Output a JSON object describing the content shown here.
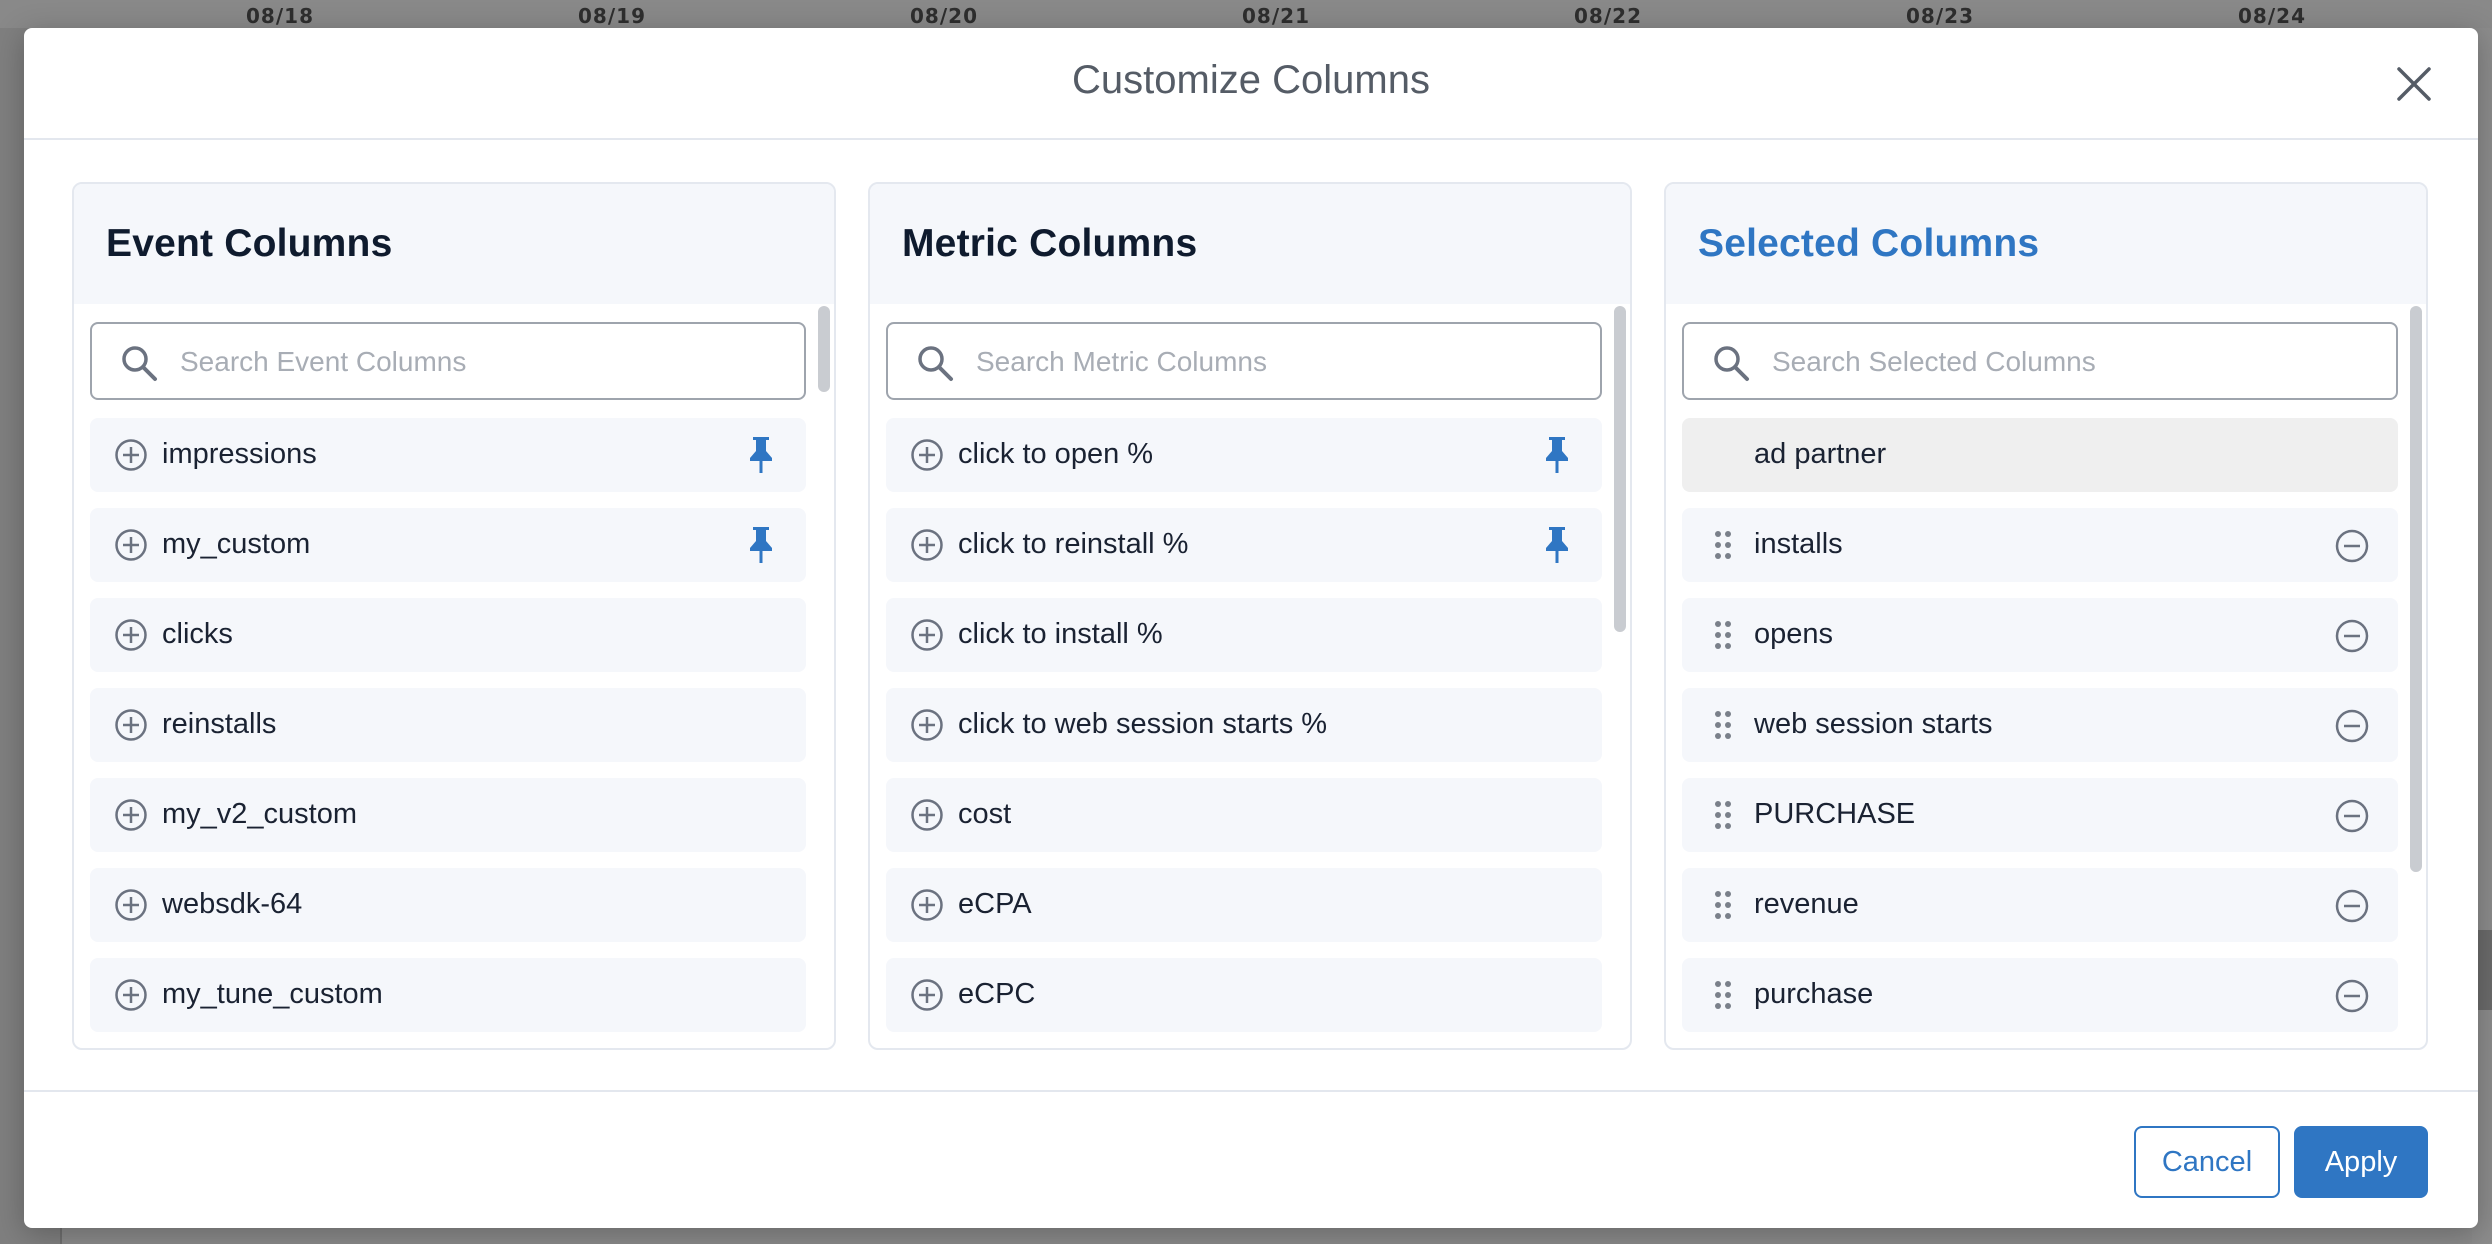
{
  "background": {
    "date_labels": [
      "08/18",
      "08/19",
      "08/20",
      "08/21",
      "08/22",
      "08/23",
      "08/24"
    ]
  },
  "modal": {
    "title": "Customize Columns",
    "close_icon": "close-icon"
  },
  "event_columns": {
    "title": "Event Columns",
    "search_placeholder": "Search Event Columns",
    "items": [
      {
        "label": "impressions",
        "pinned": true
      },
      {
        "label": "my_custom",
        "pinned": true
      },
      {
        "label": "clicks",
        "pinned": false
      },
      {
        "label": "reinstalls",
        "pinned": false
      },
      {
        "label": "my_v2_custom",
        "pinned": false
      },
      {
        "label": "websdk-64",
        "pinned": false
      },
      {
        "label": "my_tune_custom",
        "pinned": false
      }
    ]
  },
  "metric_columns": {
    "title": "Metric Columns",
    "search_placeholder": "Search Metric Columns",
    "items": [
      {
        "label": "click to open %",
        "pinned": true
      },
      {
        "label": "click to reinstall %",
        "pinned": true
      },
      {
        "label": "click to install %",
        "pinned": false
      },
      {
        "label": "click to web session starts %",
        "pinned": false
      },
      {
        "label": "cost",
        "pinned": false
      },
      {
        "label": "eCPA",
        "pinned": false
      },
      {
        "label": "eCPC",
        "pinned": false
      }
    ]
  },
  "selected_columns": {
    "title": "Selected Columns",
    "search_placeholder": "Search Selected Columns",
    "fixed_item": "ad partner",
    "items": [
      {
        "label": "installs"
      },
      {
        "label": "opens"
      },
      {
        "label": "web session starts"
      },
      {
        "label": "PURCHASE"
      },
      {
        "label": "revenue"
      },
      {
        "label": "purchase"
      }
    ]
  },
  "footer": {
    "cancel_label": "Cancel",
    "apply_label": "Apply"
  },
  "colors": {
    "accent": "#2f76c3",
    "pin": "#2f76c3",
    "row_bg": "#f5f7fb",
    "fixed_row_bg": "#efefef"
  }
}
